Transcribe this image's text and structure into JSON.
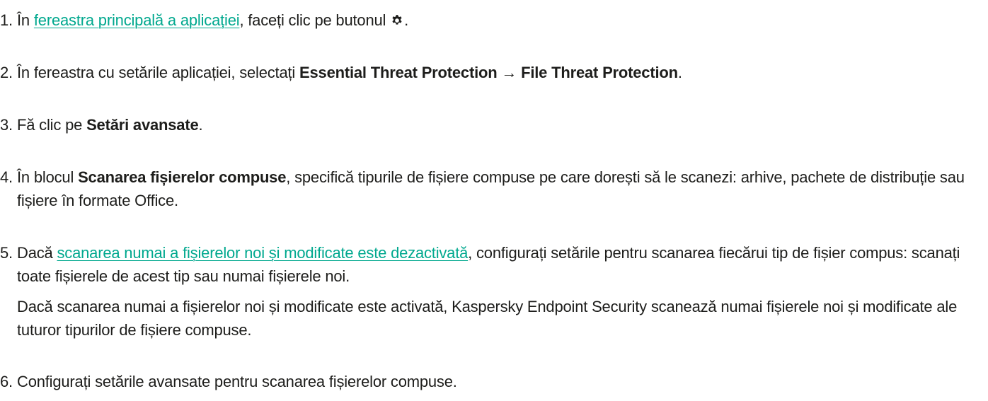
{
  "steps": [
    {
      "num": "1.",
      "t1": "În ",
      "link": "fereastra principală a aplicației",
      "t2": ", faceți clic pe butonul ",
      "icon": "gear-icon",
      "t3": "."
    },
    {
      "num": "2.",
      "t1": "În fereastra cu setările aplicației, selectați ",
      "b1": "Essential Threat Protection",
      "arrow": " → ",
      "b2": "File Threat Protection",
      "t2": "."
    },
    {
      "num": "3.",
      "t1": "Fă clic pe ",
      "b1": "Setări avansate",
      "t2": "."
    },
    {
      "num": "4.",
      "t1": "În blocul ",
      "b1": "Scanarea fișierelor compuse",
      "t2": ", specifică tipurile de fișiere compuse pe care dorești să le scanezi: arhive, pachete de distribuție sau fișiere în formate Office."
    },
    {
      "num": "5.",
      "t1": "Dacă ",
      "link": "scanarea numai a fișierelor noi și modificate este dezactivată",
      "t2": ", configurați setările pentru scanarea fiecărui tip de fișier compus: scanați toate fișierele de acest tip sau numai fișierele noi.",
      "sub": "Dacă scanarea numai a fișierelor noi și modificate este activată, Kaspersky Endpoint Security scanează numai fișierele noi și modificate ale tuturor tipurilor de fișiere compuse."
    },
    {
      "num": "6.",
      "t1": "Configurați setările avansate pentru scanarea fișierelor compuse."
    }
  ],
  "colors": {
    "text": "#1d1d1b",
    "link": "#00a88e"
  }
}
